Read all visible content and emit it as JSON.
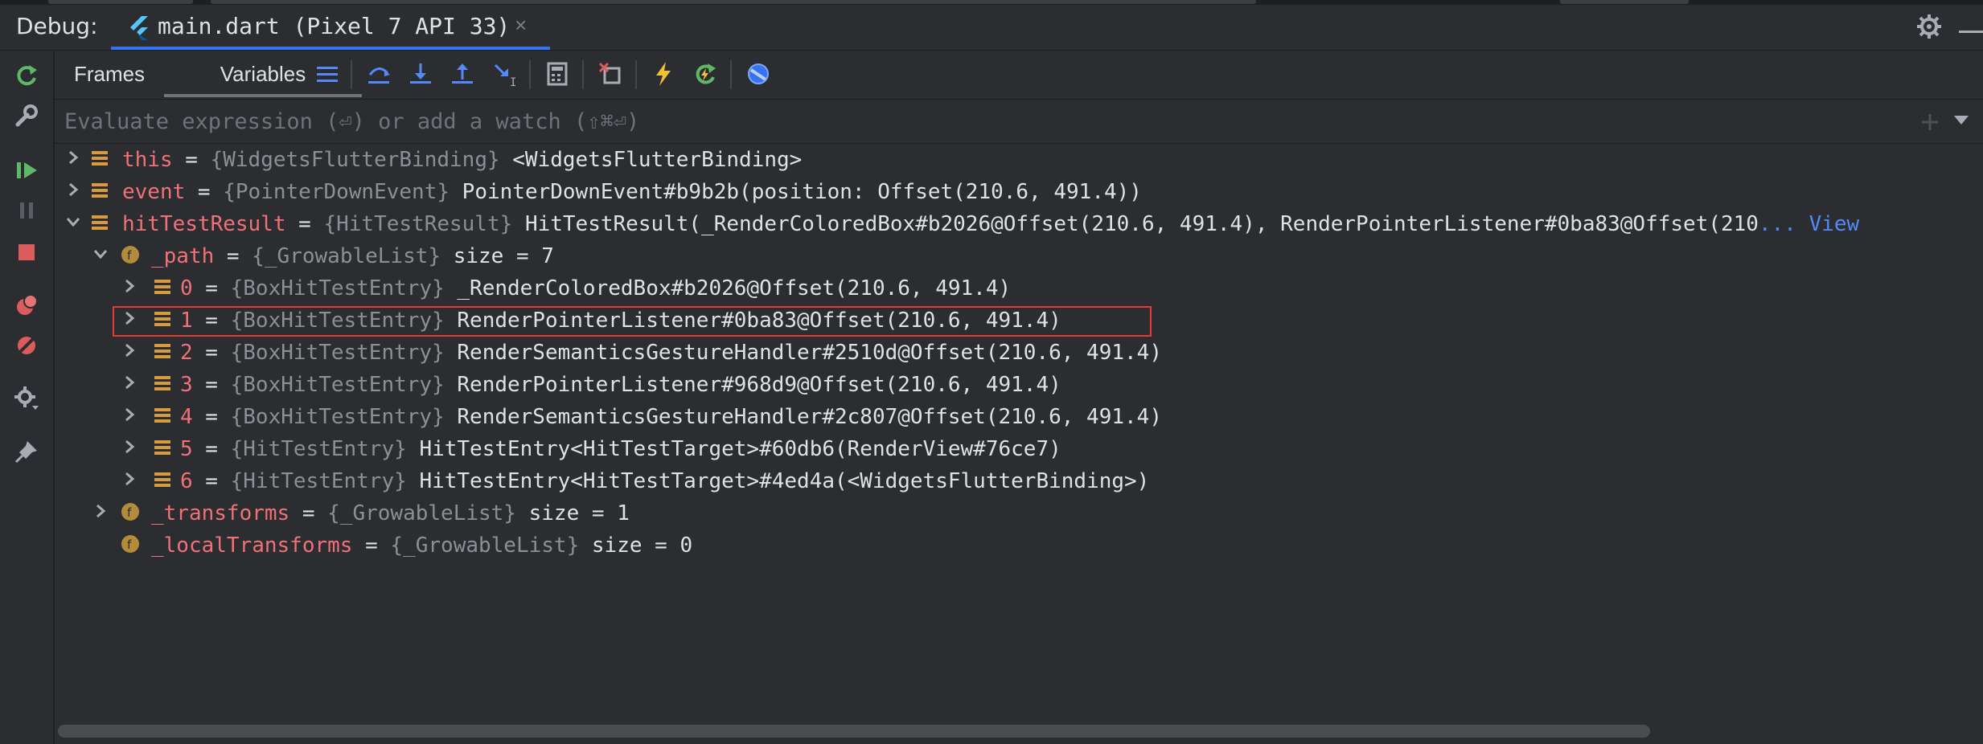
{
  "title_bar": {
    "debug_label": "Debug:",
    "session_tab": "main.dart (Pixel 7 API 33)",
    "close_glyph": "×"
  },
  "toolbar": {
    "tabs": [
      "Frames",
      "Variables"
    ],
    "active_tab": "Variables",
    "icons": [
      "list-icon",
      "step-over-icon",
      "step-into-icon",
      "step-out-icon",
      "run-to-cursor-icon",
      "evaluate-icon",
      "clear-breakpoints-icon",
      "hot-reload-icon",
      "hot-restart-icon",
      "devtools-icon"
    ]
  },
  "left_toolbar": {
    "icons": [
      "rerun-icon",
      "wrench-icon",
      "resume-icon",
      "pause-icon",
      "stop-icon",
      "view-breakpoints-icon",
      "mute-breakpoints-icon",
      "settings-icon",
      "pin-icon"
    ]
  },
  "evaluate": {
    "placeholder": "Evaluate expression (⏎) or add a watch (⇧⌘⏎)"
  },
  "variables": [
    {
      "name": "this",
      "type": "{WidgetsFlutterBinding}",
      "value": "<WidgetsFlutterBinding>",
      "expanded": false
    },
    {
      "name": "event",
      "type": "{PointerDownEvent}",
      "value": "PointerDownEvent#b9b2b(position: Offset(210.6, 491.4))",
      "expanded": false
    },
    {
      "name": "hitTestResult",
      "type": "{HitTestResult}",
      "value": "HitTestResult(_RenderColoredBox#b2026@Offset(210.6, 491.4), RenderPointerListener#0ba83@Offset(210",
      "more": "... View",
      "expanded": true
    },
    {
      "name": "_path",
      "type": "{_GrowableList}",
      "value": "size = 7",
      "expanded": true
    },
    {
      "name": "0",
      "type": "{BoxHitTestEntry}",
      "value": "_RenderColoredBox#b2026@Offset(210.6, 491.4)"
    },
    {
      "name": "1",
      "type": "{BoxHitTestEntry}",
      "value": "RenderPointerListener#0ba83@Offset(210.6, 491.4)",
      "highlighted": true
    },
    {
      "name": "2",
      "type": "{BoxHitTestEntry}",
      "value": "RenderSemanticsGestureHandler#2510d@Offset(210.6, 491.4)"
    },
    {
      "name": "3",
      "type": "{BoxHitTestEntry}",
      "value": "RenderPointerListener#968d9@Offset(210.6, 491.4)"
    },
    {
      "name": "4",
      "type": "{BoxHitTestEntry}",
      "value": "RenderSemanticsGestureHandler#2c807@Offset(210.6, 491.4)"
    },
    {
      "name": "5",
      "type": "{HitTestEntry}",
      "value": "HitTestEntry<HitTestTarget>#60db6(RenderView#76ce7)"
    },
    {
      "name": "6",
      "type": "{HitTestEntry}",
      "value": "HitTestEntry<HitTestTarget>#4ed4a(<WidgetsFlutterBinding>)"
    },
    {
      "name": "_transforms",
      "type": "{_GrowableList}",
      "value": "size = 1",
      "expanded": false
    },
    {
      "name": "_localTransforms",
      "type": "{_GrowableList}",
      "value": "size = 0"
    }
  ],
  "colors": {
    "background": "#2b2d30",
    "var_name": "#f07178",
    "type_hint": "#8c8f95",
    "link": "#548af7",
    "highlight_border": "#e53935",
    "accent": "#3574f0"
  }
}
